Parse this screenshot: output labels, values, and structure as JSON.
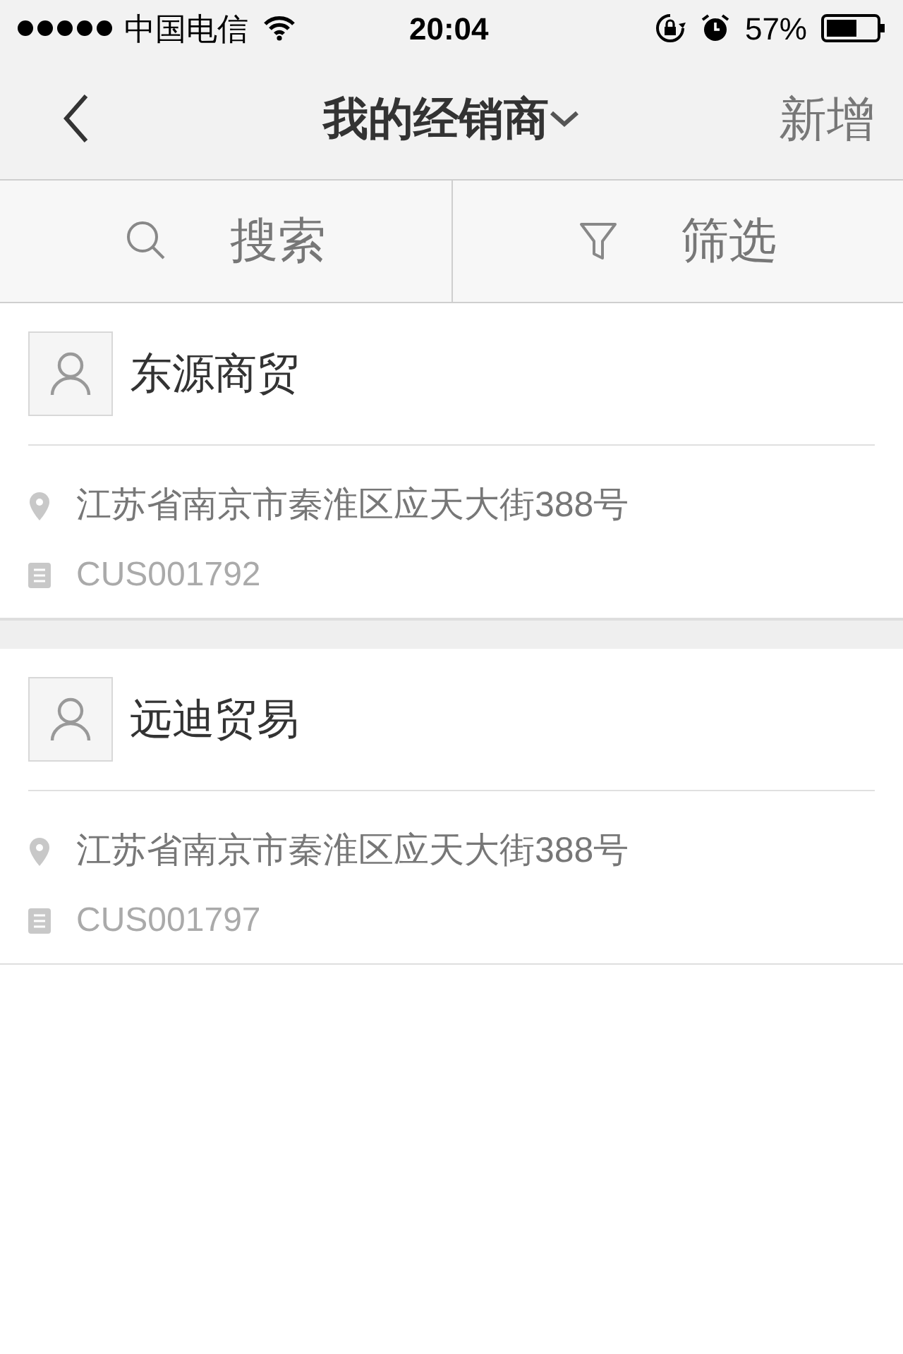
{
  "status_bar": {
    "carrier": "中国电信",
    "time": "20:04",
    "battery": "57%"
  },
  "nav": {
    "title": "我的经销商",
    "action": "新增"
  },
  "toolbar": [
    {
      "kind": "search",
      "label": "搜索"
    },
    {
      "kind": "filter",
      "label": "筛选"
    }
  ],
  "dealers": [
    {
      "name": "东源商贸",
      "address": "江苏省南京市秦淮区应天大街388号",
      "code": "CUS001792"
    },
    {
      "name": "远迪贸易",
      "address": "江苏省南京市秦淮区应天大街388号",
      "code": "CUS001797"
    }
  ]
}
